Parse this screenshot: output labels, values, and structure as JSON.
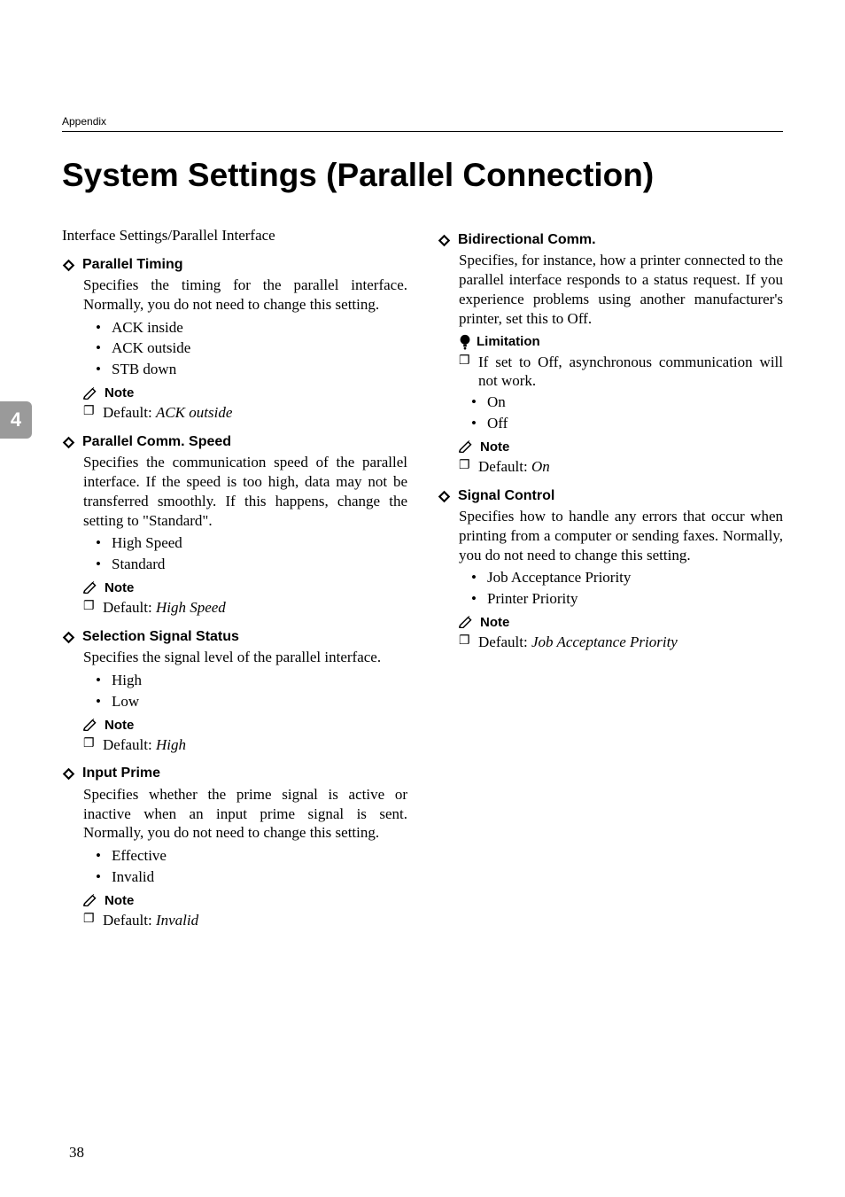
{
  "running_head": "Appendix",
  "title": "System Settings (Parallel Connection)",
  "intro": "Interface Settings/Parallel Interface",
  "side_tab": "4",
  "page_number": "38",
  "labels": {
    "note": "Note",
    "limitation": "Limitation",
    "default_prefix": "Default: "
  },
  "left": {
    "parallel_timing": {
      "title": "Parallel Timing",
      "desc": "Specifies the timing for the parallel interface. Normally, you do not need to change this setting.",
      "opts": [
        "ACK inside",
        "ACK outside",
        "STB down"
      ],
      "default": "ACK outside"
    },
    "parallel_comm_speed": {
      "title": "Parallel Comm. Speed",
      "desc": "Specifies the communication speed of the parallel interface. If the speed is too high, data may not be transferred smoothly. If this happens, change the setting to \"Standard\".",
      "opts": [
        "High Speed",
        "Standard"
      ],
      "default": "High Speed"
    },
    "selection_signal_status": {
      "title": "Selection Signal Status",
      "desc": "Specifies the signal level of the parallel interface.",
      "opts": [
        "High",
        "Low"
      ],
      "default": "High"
    },
    "input_prime": {
      "title": "Input Prime",
      "desc": "Specifies whether the prime signal is active or inactive when an input prime signal is sent. Normally, you do not need to change this setting.",
      "opts": [
        "Effective",
        "Invalid"
      ],
      "default": "Invalid"
    }
  },
  "right": {
    "bidirectional": {
      "title": "Bidirectional Comm.",
      "desc": "Specifies, for instance, how a printer connected to the parallel interface responds to a status request. If you experience problems using another manufacturer's printer, set this to Off.",
      "limitation": "If set to Off, asynchronous communication will not work.",
      "opts": [
        "On",
        "Off"
      ],
      "default": "On"
    },
    "signal_control": {
      "title": "Signal Control",
      "desc": "Specifies how to handle any errors that occur when printing from a computer or sending faxes. Normally, you do not need to change this setting.",
      "opts": [
        "Job Acceptance Priority",
        "Printer Priority"
      ],
      "default": "Job Acceptance Priority"
    }
  }
}
